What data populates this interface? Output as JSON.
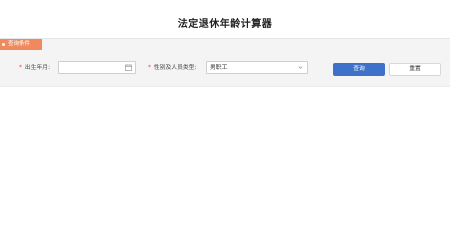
{
  "page": {
    "title": "法定退休年龄计算器"
  },
  "query_panel": {
    "tag_label": "查询条件",
    "birth_field": {
      "required_mark": "*",
      "label": "出生年月:",
      "value": "",
      "icon": "calendar-icon"
    },
    "type_field": {
      "required_mark": "*",
      "label": "性别及人员类型:",
      "selected": "男职工",
      "icon": "chevron-down-icon"
    },
    "buttons": {
      "query_label": "查询",
      "reset_label": "重置"
    }
  },
  "colors": {
    "accent": "#3e72c9",
    "tag": "#f08a5d",
    "required": "#e84a3a"
  }
}
